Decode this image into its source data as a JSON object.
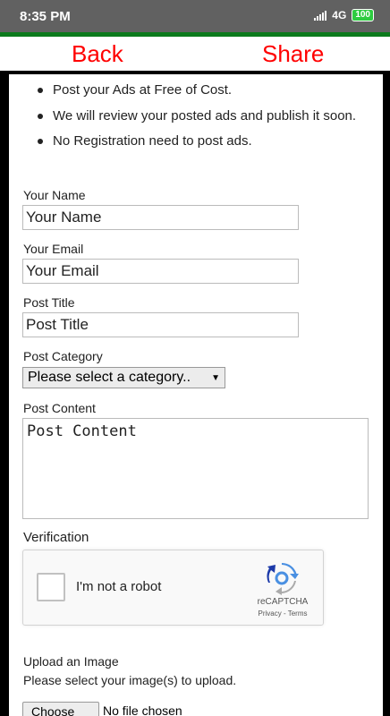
{
  "status_bar": {
    "time": "8:35 PM",
    "network": "4G",
    "battery": "100"
  },
  "app_bar": {
    "back_label": "Back",
    "share_label": "Share"
  },
  "info_bullets": [
    "Post your Ads at Free of Cost.",
    "We will review your posted ads and publish it soon.",
    "No Registration need to post ads."
  ],
  "form": {
    "name": {
      "label": "Your Name",
      "placeholder": "Your Name"
    },
    "email": {
      "label": "Your Email",
      "placeholder": "Your Email"
    },
    "title": {
      "label": "Post Title",
      "placeholder": "Post Title"
    },
    "category": {
      "label": "Post Category",
      "selected": "Please select a category.."
    },
    "content": {
      "label": "Post Content",
      "placeholder": "Post Content"
    }
  },
  "verification": {
    "label": "Verification",
    "checkbox_text": "I'm not a robot",
    "brand": "reCAPTCHA",
    "privacy": "Privacy",
    "terms": "Terms",
    "separator": " - "
  },
  "upload": {
    "label": "Upload an Image",
    "help": "Please select your image(s) to upload.",
    "button": "Choose file",
    "status": "No file chosen"
  },
  "colors": {
    "accent_red": "#ff0000",
    "status_green": "#0b7a1c"
  }
}
